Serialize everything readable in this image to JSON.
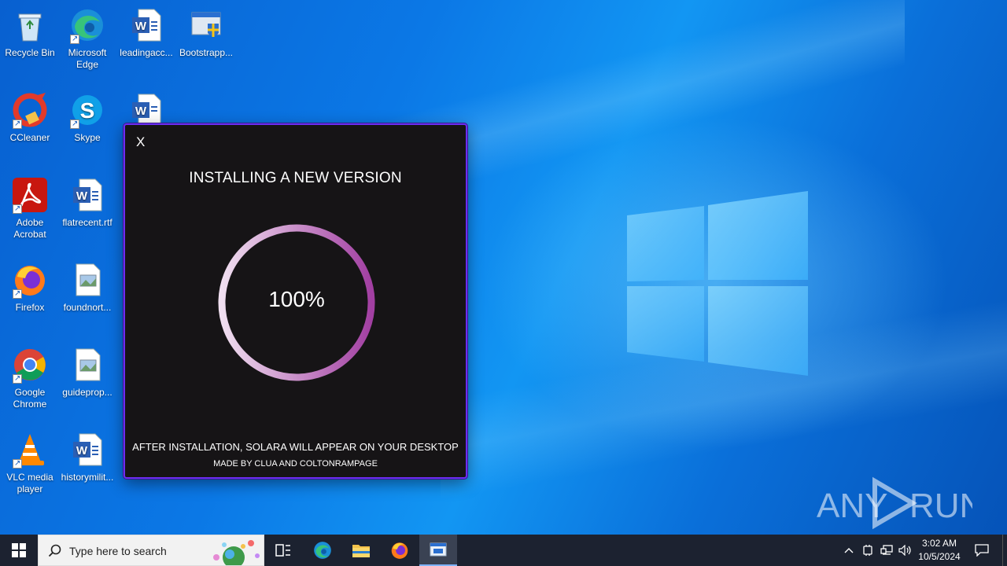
{
  "desktop_icons": [
    {
      "label": "Recycle Bin",
      "icon": "recycle-bin-icon"
    },
    {
      "label": "Microsoft Edge",
      "icon": "edge-icon"
    },
    {
      "label": "leadingacc...",
      "icon": "word-document-icon"
    },
    {
      "label": "Bootstrapp...",
      "icon": "installer-icon"
    },
    {
      "label": "CCleaner",
      "icon": "ccleaner-icon"
    },
    {
      "label": "Skype",
      "icon": "skype-icon"
    },
    {
      "label": "",
      "icon": "word-document-icon"
    },
    {
      "label": "Adobe Acrobat",
      "icon": "acrobat-icon"
    },
    {
      "label": "flatrecent.rtf",
      "icon": "word-document-icon"
    },
    {
      "label": "Firefox",
      "icon": "firefox-icon"
    },
    {
      "label": "foundnort...",
      "icon": "image-file-icon"
    },
    {
      "label": "Google Chrome",
      "icon": "chrome-icon"
    },
    {
      "label": "guideprop...",
      "icon": "image-file-icon"
    },
    {
      "label": "VLC media player",
      "icon": "vlc-icon"
    },
    {
      "label": "historymilit...",
      "icon": "word-document-icon"
    }
  ],
  "installer": {
    "close_label": "X",
    "title": "INSTALLING A NEW VERSION",
    "progress_label": "100%",
    "progress_fraction": 1.0,
    "note": "AFTER INSTALLATION, SOLARA WILL APPEAR ON YOUR DESKTOP",
    "credits": "MADE BY CLUA AND COLTONRAMPAGE",
    "accent_color": "#6b2df2",
    "ring_color": "#b04fb0"
  },
  "watermark": {
    "text": "ANY RUN"
  },
  "taskbar": {
    "search_placeholder": "Type here to search",
    "pinned": [
      "task-view-icon",
      "edge-icon",
      "file-explorer-icon",
      "firefox-icon",
      "installer-window-icon"
    ],
    "clock_time": "3:02 AM",
    "clock_date": "10/5/2024",
    "color": "#1c2230"
  }
}
